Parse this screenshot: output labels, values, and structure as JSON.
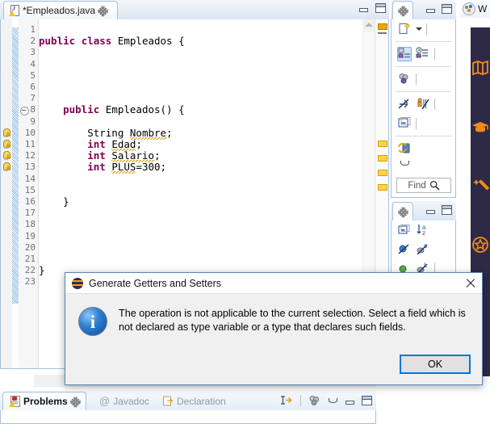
{
  "editor": {
    "tab": {
      "label": "*Empleados.java",
      "icon": "java-file-warning-icon",
      "close": "close-icon"
    },
    "controls": {
      "minimize": "minimize-icon",
      "maximize": "maximize-icon"
    },
    "current_line": 19,
    "lines": [
      {
        "n": 1,
        "text": ""
      },
      {
        "n": 2,
        "text": "public class Empleados {",
        "tokens": [
          {
            "t": "public",
            "k": true
          },
          {
            "t": " "
          },
          {
            "t": "class",
            "k": true
          },
          {
            "t": " Empleados {"
          }
        ]
      },
      {
        "n": 3,
        "text": ""
      },
      {
        "n": 4,
        "text": ""
      },
      {
        "n": 5,
        "text": ""
      },
      {
        "n": 6,
        "text": ""
      },
      {
        "n": 7,
        "text": ""
      },
      {
        "n": 8,
        "text": "    public Empleados() {",
        "fold": true,
        "tokens": [
          {
            "t": "    "
          },
          {
            "t": "public",
            "k": true
          },
          {
            "t": " Empleados() {"
          }
        ]
      },
      {
        "n": 9,
        "text": ""
      },
      {
        "n": 10,
        "text": "        String Nombre;",
        "warn": true,
        "tokens": [
          {
            "t": "        String "
          },
          {
            "t": "Nombre",
            "sq": true
          },
          {
            "t": ";"
          }
        ]
      },
      {
        "n": 11,
        "text": "        int Edad;",
        "warn": true,
        "tokens": [
          {
            "t": "        "
          },
          {
            "t": "int",
            "k": true
          },
          {
            "t": " "
          },
          {
            "t": "Edad",
            "sq": true
          },
          {
            "t": ";"
          }
        ]
      },
      {
        "n": 12,
        "text": "        int Salario;",
        "warn": true,
        "tokens": [
          {
            "t": "        "
          },
          {
            "t": "int",
            "k": true
          },
          {
            "t": " "
          },
          {
            "t": "Salario",
            "sq": true
          },
          {
            "t": ";"
          }
        ]
      },
      {
        "n": 13,
        "text": "        int PLUS=300;",
        "warn": true,
        "tokens": [
          {
            "t": "        "
          },
          {
            "t": "int",
            "k": true
          },
          {
            "t": " "
          },
          {
            "t": "PLUS",
            "sq": true
          },
          {
            "t": "=300;"
          }
        ]
      },
      {
        "n": 14,
        "text": ""
      },
      {
        "n": 15,
        "text": ""
      },
      {
        "n": 16,
        "text": "    }",
        "tokens": [
          {
            "t": "    }"
          }
        ]
      },
      {
        "n": 17,
        "text": ""
      },
      {
        "n": 18,
        "text": ""
      },
      {
        "n": 19,
        "text": ""
      },
      {
        "n": 20,
        "text": ""
      },
      {
        "n": 21,
        "text": ""
      },
      {
        "n": 22,
        "text": "}",
        "tokens": [
          {
            "t": "}"
          }
        ]
      },
      {
        "n": 23,
        "text": ""
      }
    ],
    "scroll_left_arrow": "«",
    "overview_markers": 4
  },
  "right_panel_top": {
    "tab_icon": "view-restore-icon",
    "controls": {
      "minimize": "minimize-icon",
      "maximize": "maximize-icon"
    },
    "toolbar": [
      {
        "name": "new-java-package-icon",
        "dropdown": true
      },
      {
        "name": "hierarchy-layout-icon",
        "selected": true
      },
      {
        "name": "history-layout-icon",
        "selected": false
      },
      {
        "name": "link-with-editor-icon"
      },
      {
        "name": "hide-fields-icon"
      },
      {
        "name": "hide-static-icon"
      },
      {
        "name": "collapse-all-icon"
      },
      {
        "name": "refresh-icon"
      },
      {
        "name": "view-menu-icon"
      }
    ],
    "find": {
      "label": "Find",
      "icon": "search-icon"
    }
  },
  "right_panel_bottom": {
    "tab_icon": "view-restore-icon",
    "controls": {
      "minimize": "minimize-icon",
      "maximize": "maximize-icon"
    },
    "toolbar": [
      {
        "name": "collapse-all-icon"
      },
      {
        "name": "sort-az-icon"
      },
      {
        "name": "hide-nonpublic-icon"
      },
      {
        "name": "hide-static-s-icon"
      },
      {
        "name": "show-public-icon"
      },
      {
        "name": "hide-local-l-icon"
      }
    ]
  },
  "workbench_tab": {
    "icon": "eclipse-perspective-icon",
    "label": "W"
  },
  "dark_sidebar": {
    "items": [
      {
        "name": "map-icon",
        "glyph": "▤"
      },
      {
        "name": "graduation-cap-icon",
        "glyph": "⚑"
      },
      {
        "name": "magic-wand-icon",
        "glyph": "✦"
      },
      {
        "name": "star-badge-icon",
        "glyph": "☆"
      }
    ],
    "accent_color": "#f08a1d",
    "background_color": "#2e2946"
  },
  "bottom_view": {
    "tabs": [
      {
        "label": "Problems",
        "icon": "problems-icon",
        "active": true,
        "close": "close-icon"
      },
      {
        "label": "Javadoc",
        "icon": "at-icon",
        "active": false
      },
      {
        "label": "Declaration",
        "icon": "declaration-icon",
        "active": false
      }
    ],
    "controls": [
      {
        "name": "focus-on-selection-icon"
      },
      {
        "name": "filters-icon"
      },
      {
        "name": "view-menu-icon"
      },
      {
        "name": "minimize-icon"
      },
      {
        "name": "maximize-icon"
      }
    ]
  },
  "dialog": {
    "title": "Generate Getters and Setters",
    "title_icon": "eclipse-icon",
    "close_icon": "close-icon",
    "info_icon": "information-icon",
    "info_glyph": "i",
    "message": "The operation is not applicable to the current selection. Select a field which is not declared as type variable or a type that declares such fields.",
    "ok_label": "OK",
    "accent_color": "#0078d7"
  }
}
